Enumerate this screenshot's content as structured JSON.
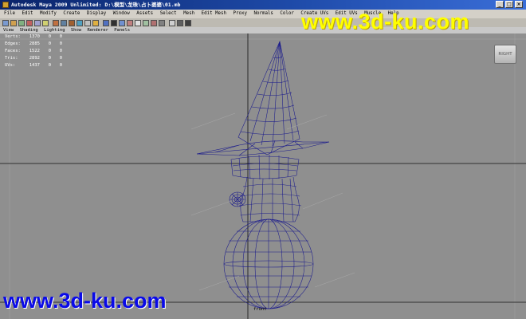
{
  "titlebar": {
    "title": "Autodesk Maya 2009 Unlimited: D:\\模型\\龙珠\\占卜婆婆\\01.mb",
    "minimize": "_",
    "maximize": "□",
    "close": "×"
  },
  "menubar": {
    "items": [
      "File",
      "Edit",
      "Modify",
      "Create",
      "Display",
      "Window",
      "Assets",
      "Select",
      "Mesh",
      "Edit Mesh",
      "Proxy",
      "Normals",
      "Color",
      "Create UVs",
      "Edit UVs",
      "Muscle",
      "Help"
    ]
  },
  "panel_menu": {
    "items": [
      "View",
      "Shading",
      "Lighting",
      "Show",
      "Renderer",
      "Panels"
    ]
  },
  "hud": {
    "rows": [
      {
        "label": "Verts:",
        "value": "1370",
        "a": "0",
        "b": "0"
      },
      {
        "label": "Edges:",
        "value": "2885",
        "a": "0",
        "b": "0"
      },
      {
        "label": "Faces:",
        "value": "1522",
        "a": "0",
        "b": "0"
      },
      {
        "label": "Tris:",
        "value": "2892",
        "a": "0",
        "b": "0"
      },
      {
        "label": "UVs:",
        "value": "1437",
        "a": "0",
        "b": "0"
      }
    ]
  },
  "viewcube": {
    "label": "RIGHT"
  },
  "camera_label": "front",
  "watermarks": {
    "top": "www.3d-ku.com",
    "bottom": "www.3d-ku.com"
  },
  "colors": {
    "wireframe": "#1a1a8c",
    "viewport_bg": "#8f8f8f",
    "titlebar": "#0a246a",
    "watermark_top": "#ffff00",
    "watermark_bottom": "#0a0ae8"
  }
}
